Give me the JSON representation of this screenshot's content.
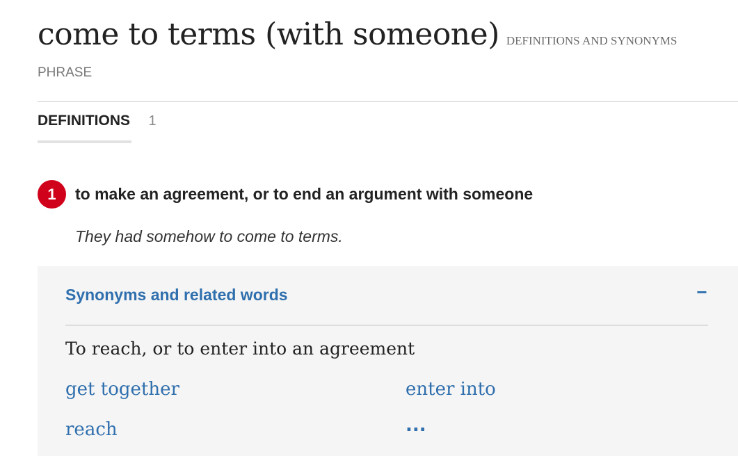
{
  "entry": {
    "headword": "come to terms (with someone)",
    "tag": "DEFINITIONS AND SYNONYMS",
    "part_of_speech": "PHRASE"
  },
  "tabs": [
    {
      "label": "DEFINITIONS",
      "count": "1"
    }
  ],
  "senses": [
    {
      "number": "1",
      "definition": "to make an agreement, or to end an argument with someone",
      "example": "They had somehow to come to terms."
    }
  ],
  "synonyms": {
    "title": "Synonyms and related words",
    "toggle": "−",
    "sense_label": "To reach, or to enter into an agreement",
    "words": [
      "get together",
      "enter into",
      "reach",
      "..."
    ]
  },
  "colors": {
    "accent_red": "#d0021b",
    "link_blue": "#2f6fad",
    "panel_bg": "#f5f5f5"
  }
}
